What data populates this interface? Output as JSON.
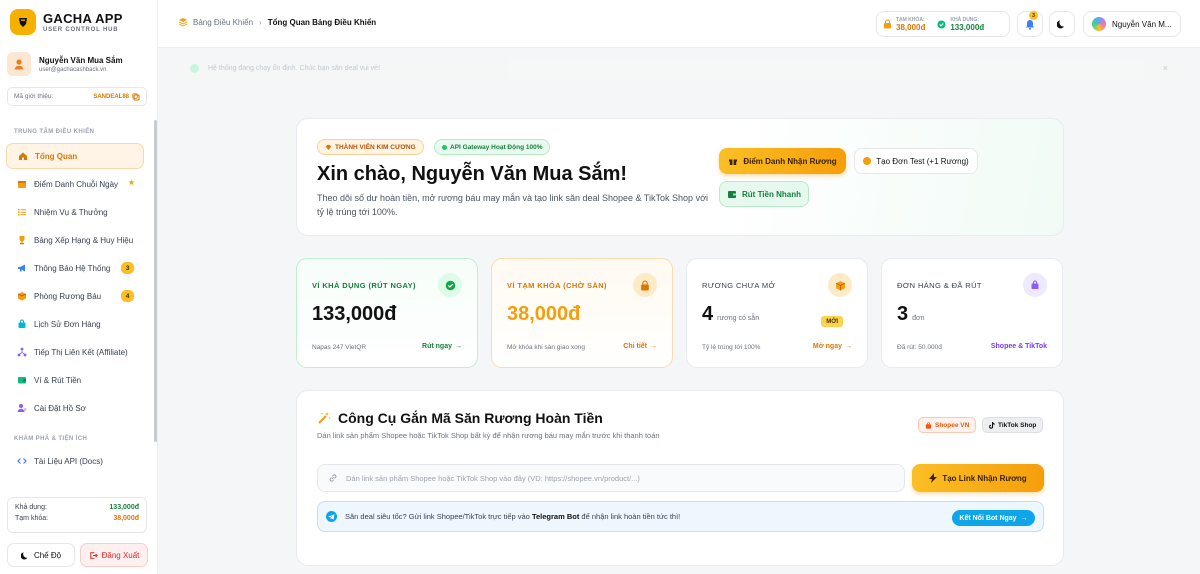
{
  "brand": {
    "name": "GACHA APP",
    "subtitle": "USER CONTROL HUB",
    "color": "#f6b000"
  },
  "user": {
    "name": "Nguyễn Văn Mua Sắm",
    "email": "user@gachacashback.vn"
  },
  "referral": {
    "label": "Mã giới thiệu:",
    "code": "SANDEAL88"
  },
  "sidebar": {
    "section_main": "TRUNG TÂM ĐIỀU KHIỂN",
    "section_explore": "KHÁM PHÁ & TIỆN ÍCH",
    "items": [
      {
        "label": "Tổng Quan",
        "icon": "home-icon",
        "active": true
      },
      {
        "label": "Điểm Danh Chuỗi Ngày",
        "icon": "calendar-icon",
        "star": "★"
      },
      {
        "label": "Nhiệm Vụ & Thưởng",
        "icon": "list-icon"
      },
      {
        "label": "Bảng Xếp Hạng & Huy Hiệu",
        "icon": "trophy-icon"
      },
      {
        "label": "Thông Báo Hệ Thống",
        "icon": "megaphone-icon",
        "badge": "3"
      },
      {
        "label": "Phòng Rương Báu",
        "icon": "box-icon",
        "badge": "4"
      },
      {
        "label": "Lịch Sử Đơn Hàng",
        "icon": "bag-icon"
      },
      {
        "label": "Tiếp Thị Liên Kết (Affiliate)",
        "icon": "network-icon"
      },
      {
        "label": "Ví & Rút Tiền",
        "icon": "wallet-icon"
      },
      {
        "label": "Cài Đặt Hồ Sơ",
        "icon": "user-gear-icon"
      }
    ],
    "explore_items": [
      {
        "label": "Tài Liệu API (Docs)",
        "icon": "code-icon"
      }
    ],
    "balance": {
      "available_label": "Khả dụng:",
      "available_value": "133,000đ",
      "locked_label": "Tạm khóa:",
      "locked_value": "38,000đ"
    },
    "mode_label": "Chế Độ",
    "logout_label": "Đăng Xuất"
  },
  "header": {
    "breadcrumb_root": "Bảng Điều Khiển",
    "breadcrumb_current": "Tổng Quan Bảng Điều Khiển",
    "locked_label": "TẠM KHÓA:",
    "locked_value": "38,000đ",
    "available_label": "KHẢ DỤNG:",
    "available_value": "133,000đ",
    "notif_count": "3",
    "user_short": "Nguyễn Văn M..."
  },
  "notice": {
    "text": "Hệ thống đang chạy ổn định. Chúc bạn săn deal vui vẻ!",
    "close": "×"
  },
  "welcome": {
    "tag_vip": "THÀNH VIÊN KIM CƯƠNG",
    "tag_api": "API Gateway Hoạt Động 100%",
    "title": "Xin chào, Nguyễn Văn Mua Sắm!",
    "description": "Theo dõi số dư hoàn tiền, mở rương báu may mắn và tạo link săn deal Shopee & TikTok Shop với tỷ lệ trúng tới 100%.",
    "btn_checkin": "Điểm Danh Nhận Rương",
    "btn_test": "Tạo Đơn Test (+1 Rương)",
    "btn_withdraw": "Rút Tiền Nhanh"
  },
  "stats": [
    {
      "label": "VÍ KHẢ DỤNG (RÚT NGAY)",
      "value": "133,000đ",
      "unit": "",
      "foot": "Napas 247 VietQR",
      "link": "Rút ngay",
      "color": "#15803d",
      "icon": "check-icon"
    },
    {
      "label": "VÍ TẠM KHÓA (CHỜ SÀN)",
      "value": "38,000đ",
      "unit": "",
      "foot": "Mở khóa khi sàn giao xong",
      "link": "Chi tiết",
      "color": "#d97706",
      "icon": "lock-icon"
    },
    {
      "label": "RƯƠNG CHƯA MỞ",
      "value": "4",
      "unit": "rương có sẵn",
      "badge": "MỚI",
      "foot": "Tỷ lệ trúng tới 100%",
      "link": "Mở ngay",
      "color": "#374151",
      "icon": "box-icon"
    },
    {
      "label": "ĐƠN HÀNG & ĐÃ RÚT",
      "value": "3",
      "unit": "đơn",
      "foot": "Đã rút: 50.000đ",
      "link": "Shopee & TikTok",
      "color": "#374151",
      "icon": "bag-icon"
    }
  ],
  "tool": {
    "title": "Công Cụ Gắn Mã Săn Rương Hoàn Tiền",
    "subtitle": "Dán link sản phẩm Shopee hoặc TikTok Shop bất kỳ để nhận rương báu may mắn trước khi thanh toán",
    "chip_shopee": "Shopee VN",
    "chip_tiktok": "TikTok Shop",
    "input_placeholder": "Dán link sản phẩm Shopee hoặc TikTok Shop vào đây (VD: https://shopee.vn/product/...)",
    "input_value": "",
    "generate_label": "Tạo Link Nhận Rương",
    "telegram_pre": "Săn deal siêu tốc? Gửi link Shopee/TikTok trực tiếp vào",
    "telegram_bot": "Telegram Bot",
    "telegram_post": "để nhận link hoàn tiền tức thì!",
    "telegram_btn": "Kết Nối Bot Ngay"
  }
}
